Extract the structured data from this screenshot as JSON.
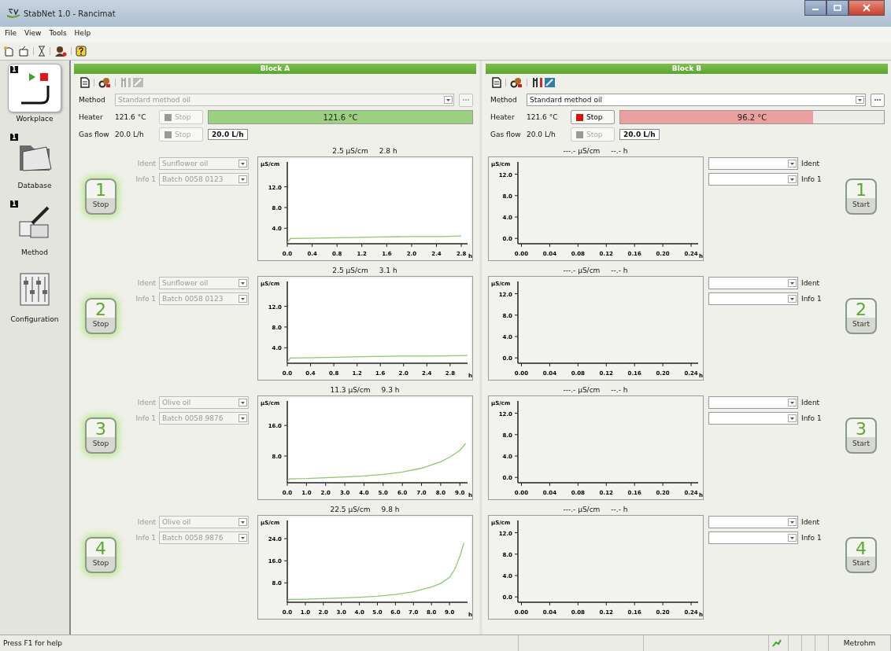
{
  "window": {
    "title": "StabNet 1.0 - Rancimat"
  },
  "menu": [
    "File",
    "View",
    "Tools",
    "Help"
  ],
  "sidebar": {
    "items": [
      {
        "label": "Workplace",
        "kind": "workplace",
        "badge": "1",
        "selected": true
      },
      {
        "label": "Database",
        "kind": "database",
        "badge": "1",
        "selected": false
      },
      {
        "label": "Method",
        "kind": "method",
        "badge": "1",
        "selected": false
      },
      {
        "label": "Configuration",
        "kind": "configuration",
        "selected": false
      }
    ]
  },
  "blocks": [
    {
      "title": "Block A",
      "tools_enabled": false,
      "method": {
        "label": "Method",
        "value": "Standard method oil",
        "disabled": true
      },
      "heater": {
        "label": "Heater",
        "reading": "121.6 °C",
        "stop_label": "Stop",
        "stop_enabled": false,
        "bar_text": "121.6 °C",
        "level": 1.0,
        "color": "#9cd080"
      },
      "gas_flow": {
        "label": "Gas flow",
        "reading": "20.0 L/h",
        "stop_label": "Stop",
        "stop_enabled": false,
        "value": "20.0 L/h"
      },
      "positions": [
        {
          "number": "1",
          "action": "Stop",
          "running": true,
          "ident": {
            "label": "Ident",
            "value": "Sunflower oil",
            "disabled": true
          },
          "info": {
            "label": "Info 1",
            "value": "Batch 0058 0123",
            "disabled": true
          },
          "reading": "2.5 µS/cm",
          "time": "2.8 h",
          "chart_data": {
            "type": "line",
            "xlabel": "h",
            "ylabel": "µS/cm",
            "xlim": [
              0,
              2.9
            ],
            "ylim": [
              1,
              16.5
            ],
            "xticks": [
              {
                "value": 0,
                "label": "0.0"
              },
              {
                "value": 0.4,
                "label": "0.4"
              },
              {
                "value": 0.8,
                "label": "0.8"
              },
              {
                "value": 1.2,
                "label": "1.2"
              },
              {
                "value": 1.6,
                "label": "1.6"
              },
              {
                "value": 2.0,
                "label": "2.0"
              },
              {
                "value": 2.4,
                "label": "2.4"
              },
              {
                "value": 2.8,
                "label": "2.8"
              }
            ],
            "yticks": [
              {
                "value": 4,
                "label": "4.0"
              },
              {
                "value": 8,
                "label": "8.0"
              },
              {
                "value": 12,
                "label": "12.0"
              }
            ],
            "x": [
              0,
              0.05,
              0.5,
              1,
              1.5,
              2,
              2.5,
              2.8
            ],
            "series": [
              {
                "color": "#8cc96b",
                "values": [
                  1.2,
                  2.0,
                  2.1,
                  2.2,
                  2.3,
                  2.4,
                  2.4,
                  2.5
                ]
              }
            ]
          }
        },
        {
          "number": "2",
          "action": "Stop",
          "running": true,
          "ident": {
            "label": "Ident",
            "value": "Sunflower oil",
            "disabled": true
          },
          "info": {
            "label": "Info 1",
            "value": "Batch 0058 0123",
            "disabled": true
          },
          "reading": "2.5 µS/cm",
          "time": "3.1 h",
          "chart_data": {
            "type": "line",
            "xlabel": "h",
            "ylabel": "µS/cm",
            "xlim": [
              0,
              3.1
            ],
            "ylim": [
              1,
              16.5
            ],
            "xticks": [
              {
                "value": 0,
                "label": "0.0"
              },
              {
                "value": 0.4,
                "label": "0.4"
              },
              {
                "value": 0.8,
                "label": "0.8"
              },
              {
                "value": 1.2,
                "label": "1.2"
              },
              {
                "value": 1.6,
                "label": "1.6"
              },
              {
                "value": 2.0,
                "label": "2.0"
              },
              {
                "value": 2.4,
                "label": "2.4"
              },
              {
                "value": 2.8,
                "label": "2.8"
              }
            ],
            "yticks": [
              {
                "value": 4,
                "label": "4.0"
              },
              {
                "value": 8,
                "label": "8.0"
              },
              {
                "value": 12,
                "label": "12.0"
              }
            ],
            "x": [
              0,
              0.05,
              0.5,
              1,
              1.5,
              2,
              2.5,
              3.1
            ],
            "series": [
              {
                "color": "#8cc96b",
                "values": [
                  1.2,
                  2.0,
                  2.1,
                  2.2,
                  2.3,
                  2.4,
                  2.4,
                  2.5
                ]
              }
            ]
          }
        },
        {
          "number": "3",
          "action": "Stop",
          "running": true,
          "ident": {
            "label": "Ident",
            "value": "Olive oil",
            "disabled": true
          },
          "info": {
            "label": "Info 1",
            "value": "Batch 0058 9876",
            "disabled": true
          },
          "reading": "11.3 µS/cm",
          "time": "9.3 h",
          "chart_data": {
            "type": "line",
            "xlabel": "h",
            "ylabel": "µS/cm",
            "xlim": [
              0,
              9.4
            ],
            "ylim": [
              1,
              22
            ],
            "xticks": [
              {
                "value": 0,
                "label": "0.0"
              },
              {
                "value": 1,
                "label": "1.0"
              },
              {
                "value": 2,
                "label": "2.0"
              },
              {
                "value": 3,
                "label": "3.0"
              },
              {
                "value": 4,
                "label": "4.0"
              },
              {
                "value": 5,
                "label": "5.0"
              },
              {
                "value": 6,
                "label": "6.0"
              },
              {
                "value": 7,
                "label": "7.0"
              },
              {
                "value": 8,
                "label": "8.0"
              },
              {
                "value": 9,
                "label": "9.0"
              }
            ],
            "yticks": [
              {
                "value": 8,
                "label": "8.0"
              },
              {
                "value": 16,
                "label": "16.0"
              }
            ],
            "x": [
              0,
              0.1,
              1,
              2,
              3,
              4,
              5,
              6,
              7,
              8,
              8.5,
              9,
              9.3
            ],
            "series": [
              {
                "color": "#8cc96b",
                "values": [
                  1.5,
                  2,
                  2.1,
                  2.3,
                  2.5,
                  2.8,
                  3.2,
                  3.8,
                  4.8,
                  6.5,
                  7.8,
                  9.5,
                  11.3
                ]
              }
            ]
          }
        },
        {
          "number": "4",
          "action": "Stop",
          "running": true,
          "ident": {
            "label": "Ident",
            "value": "Olive oil",
            "disabled": true
          },
          "info": {
            "label": "Info 1",
            "value": "Batch 0058 9876",
            "disabled": true
          },
          "reading": "22.5 µS/cm",
          "time": "9.8 h",
          "chart_data": {
            "type": "line",
            "xlabel": "h",
            "ylabel": "µS/cm",
            "xlim": [
              0,
              10
            ],
            "ylim": [
              1,
              30
            ],
            "xticks": [
              {
                "value": 0,
                "label": "0.0"
              },
              {
                "value": 1,
                "label": "1.0"
              },
              {
                "value": 2,
                "label": "2.0"
              },
              {
                "value": 3,
                "label": "3.0"
              },
              {
                "value": 4,
                "label": "4.0"
              },
              {
                "value": 5,
                "label": "5.0"
              },
              {
                "value": 6,
                "label": "6.0"
              },
              {
                "value": 7,
                "label": "7.0"
              },
              {
                "value": 8,
                "label": "8.0"
              },
              {
                "value": 9,
                "label": "9.0"
              }
            ],
            "yticks": [
              {
                "value": 8,
                "label": "8.0"
              },
              {
                "value": 16,
                "label": "16.0"
              },
              {
                "value": 24,
                "label": "24.0"
              }
            ],
            "x": [
              0,
              0.1,
              1,
              2,
              3,
              4,
              5,
              6,
              7,
              8,
              8.5,
              9,
              9.3,
              9.6,
              9.8
            ],
            "series": [
              {
                "color": "#8cc96b",
                "values": [
                  1.5,
                  2,
                  2.1,
                  2.3,
                  2.5,
                  2.8,
                  3.2,
                  3.8,
                  4.8,
                  6.5,
                  7.8,
                  10,
                  13,
                  18,
                  22.5
                ]
              }
            ]
          }
        }
      ]
    },
    {
      "title": "Block B",
      "tools_enabled": true,
      "method": {
        "label": "Method",
        "value": "Standard method oil",
        "disabled": false
      },
      "heater": {
        "label": "Heater",
        "reading": "121.6 °C",
        "stop_label": "Stop",
        "stop_enabled": true,
        "bar_text": "96.2 °C",
        "level": 0.73,
        "color": "#eba0a0"
      },
      "gas_flow": {
        "label": "Gas flow",
        "reading": "20.0 L/h",
        "stop_label": "Stop",
        "stop_enabled": false,
        "value": "20.0 L/h"
      },
      "positions": [
        {
          "number": "1",
          "action": "Start",
          "running": false,
          "ident": {
            "label": "Ident",
            "disabled": false
          },
          "info": {
            "label": "Info 1",
            "disabled": false
          },
          "reading": "---.- µS/cm",
          "time": "--.- h",
          "chart_data": {
            "type": "line",
            "xlabel": "h",
            "ylabel": "µS/cm",
            "xlim": [
              -0.005,
              0.25
            ],
            "ylim": [
              -1,
              14
            ],
            "xticks": [
              {
                "value": 0,
                "label": "0.00"
              },
              {
                "value": 0.04,
                "label": "0.04"
              },
              {
                "value": 0.08,
                "label": "0.08"
              },
              {
                "value": 0.12,
                "label": "0.12"
              },
              {
                "value": 0.16,
                "label": "0.16"
              },
              {
                "value": 0.2,
                "label": "0.20"
              },
              {
                "value": 0.24,
                "label": "0.24"
              }
            ],
            "yticks": [
              {
                "value": 0,
                "label": "0.0"
              },
              {
                "value": 4,
                "label": "4.0"
              },
              {
                "value": 8,
                "label": "8.0"
              },
              {
                "value": 12,
                "label": "12.0"
              }
            ]
          }
        },
        {
          "number": "2",
          "action": "Start",
          "running": false,
          "ident": {
            "label": "Ident",
            "disabled": false
          },
          "info": {
            "label": "Info 1",
            "disabled": false
          },
          "reading": "---.- µS/cm",
          "time": "--.- h",
          "chart_data": {
            "type": "line",
            "xlabel": "h",
            "ylabel": "µS/cm",
            "xlim": [
              -0.005,
              0.25
            ],
            "ylim": [
              -1,
              14
            ],
            "xticks": [
              {
                "value": 0,
                "label": "0.00"
              },
              {
                "value": 0.04,
                "label": "0.04"
              },
              {
                "value": 0.08,
                "label": "0.08"
              },
              {
                "value": 0.12,
                "label": "0.12"
              },
              {
                "value": 0.16,
                "label": "0.16"
              },
              {
                "value": 0.2,
                "label": "0.20"
              },
              {
                "value": 0.24,
                "label": "0.24"
              }
            ],
            "yticks": [
              {
                "value": 0,
                "label": "0.0"
              },
              {
                "value": 4,
                "label": "4.0"
              },
              {
                "value": 8,
                "label": "8.0"
              },
              {
                "value": 12,
                "label": "12.0"
              }
            ]
          }
        },
        {
          "number": "3",
          "action": "Start",
          "running": false,
          "ident": {
            "label": "Ident",
            "disabled": false
          },
          "info": {
            "label": "Info 1",
            "disabled": false
          },
          "reading": "---.- µS/cm",
          "time": "--.- h",
          "chart_data": {
            "type": "line",
            "xlabel": "h",
            "ylabel": "µS/cm",
            "xlim": [
              -0.005,
              0.25
            ],
            "ylim": [
              -1,
              14
            ],
            "xticks": [
              {
                "value": 0,
                "label": "0.00"
              },
              {
                "value": 0.04,
                "label": "0.04"
              },
              {
                "value": 0.08,
                "label": "0.08"
              },
              {
                "value": 0.12,
                "label": "0.12"
              },
              {
                "value": 0.16,
                "label": "0.16"
              },
              {
                "value": 0.2,
                "label": "0.20"
              },
              {
                "value": 0.24,
                "label": "0.24"
              }
            ],
            "yticks": [
              {
                "value": 0,
                "label": "0.0"
              },
              {
                "value": 4,
                "label": "4.0"
              },
              {
                "value": 8,
                "label": "8.0"
              },
              {
                "value": 12,
                "label": "12.0"
              }
            ]
          }
        },
        {
          "number": "4",
          "action": "Start",
          "running": false,
          "ident": {
            "label": "Ident",
            "disabled": false
          },
          "info": {
            "label": "Info 1",
            "disabled": false
          },
          "reading": "---.- µS/cm",
          "time": "--.- h",
          "chart_data": {
            "type": "line",
            "xlabel": "h",
            "ylabel": "µS/cm",
            "xlim": [
              -0.005,
              0.25
            ],
            "ylim": [
              -1,
              14
            ],
            "xticks": [
              {
                "value": 0,
                "label": "0.00"
              },
              {
                "value": 0.04,
                "label": "0.04"
              },
              {
                "value": 0.08,
                "label": "0.08"
              },
              {
                "value": 0.12,
                "label": "0.12"
              },
              {
                "value": 0.16,
                "label": "0.16"
              },
              {
                "value": 0.2,
                "label": "0.20"
              },
              {
                "value": 0.24,
                "label": "0.24"
              }
            ],
            "yticks": [
              {
                "value": 0,
                "label": "0.0"
              },
              {
                "value": 4,
                "label": "4.0"
              },
              {
                "value": 8,
                "label": "8.0"
              },
              {
                "value": 12,
                "label": "12.0"
              }
            ]
          }
        }
      ]
    }
  ],
  "status_bar": {
    "help": "Press F1 for help",
    "vendor": "Metrohm"
  }
}
